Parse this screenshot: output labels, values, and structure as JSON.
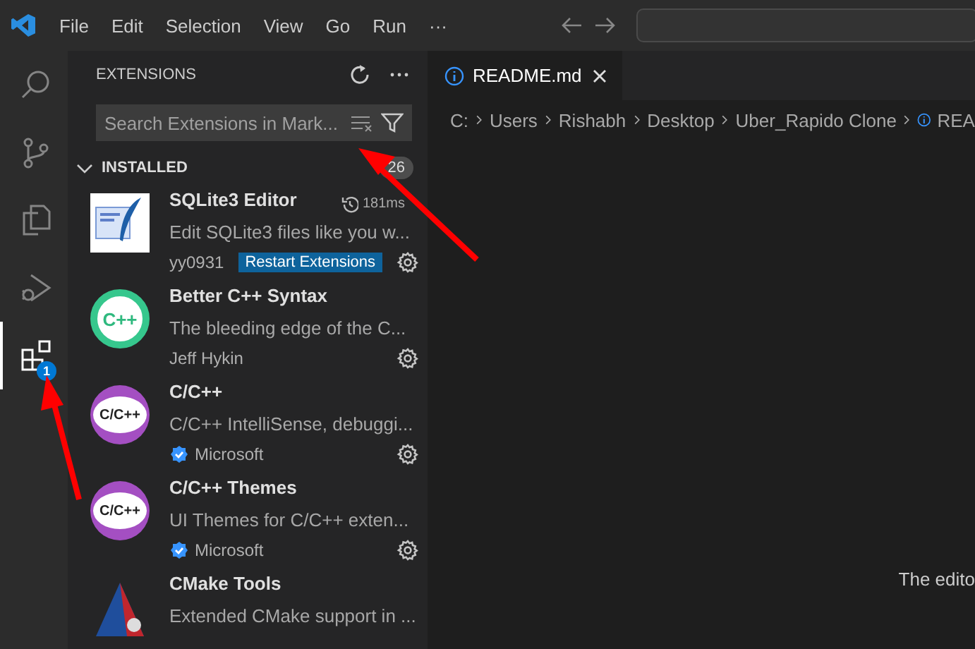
{
  "menu": [
    "File",
    "Edit",
    "Selection",
    "View",
    "Go",
    "Run",
    "···"
  ],
  "activity_bar": [
    {
      "kind": "search",
      "selected": false
    },
    {
      "kind": "source-control",
      "selected": false
    },
    {
      "kind": "explorer",
      "selected": false
    },
    {
      "kind": "run",
      "selected": false
    },
    {
      "kind": "extensions",
      "selected": true,
      "badge": "1"
    }
  ],
  "sidebar": {
    "title": "EXTENSIONS",
    "search": {
      "placeholder": "Search Extensions in Mark..."
    },
    "section": {
      "label": "INSTALLED",
      "expanded": true,
      "count": "26"
    },
    "extensions": [
      {
        "name": "SQLite3 Editor",
        "kind": "sqlite",
        "time": "181ms",
        "description": "Edit SQLite3 files like you w...",
        "publisher": "yy0931",
        "verified": false,
        "action": "Restart Extensions"
      },
      {
        "name": "Better C++ Syntax",
        "kind": "cpp-ring",
        "logo_text": "C++",
        "description": "The bleeding edge of the C...",
        "publisher": "Jeff Hykin",
        "verified": false
      },
      {
        "name": "C/C++",
        "kind": "cpp-purple",
        "logo_text": "C/C++",
        "description": "C/C++ IntelliSense, debuggi...",
        "publisher": "Microsoft",
        "verified": true
      },
      {
        "name": "C/C++ Themes",
        "kind": "cpp-purple",
        "logo_text": "C/C++",
        "description": "UI Themes for C/C++ exten...",
        "publisher": "Microsoft",
        "verified": true
      },
      {
        "name": "CMake Tools",
        "kind": "cmake",
        "description": "Extended CMake support in ..."
      }
    ]
  },
  "editor": {
    "tabs": [
      {
        "label": "README.md",
        "selected": true
      }
    ],
    "breadcrumb": [
      "C:",
      "Users",
      "Rishabh",
      "Desktop",
      "Uber_Rapido Clone",
      "REA"
    ],
    "message": "The edito"
  }
}
